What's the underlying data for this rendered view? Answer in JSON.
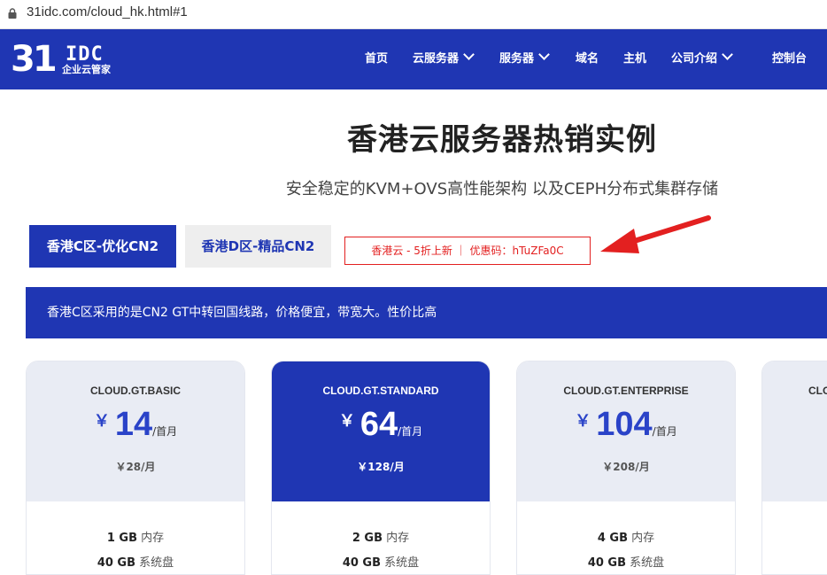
{
  "browser": {
    "url": "31idc.com/cloud_hk.html#1"
  },
  "header": {
    "logo": {
      "number": "31",
      "letters": "IDC",
      "sub": "企业云管家"
    },
    "nav": [
      {
        "label": "首页"
      },
      {
        "label": "云服务器"
      },
      {
        "label": "服务器"
      },
      {
        "label": "域名"
      },
      {
        "label": "主机"
      },
      {
        "label": "公司介绍"
      },
      {
        "label": "控制台"
      }
    ]
  },
  "hero": {
    "title": "香港云服务器热销实例",
    "subtitle": "安全稳定的KVM+OVS高性能架构 以及CEPH分布式集群存储"
  },
  "tabs": [
    {
      "label": "香港C区-优化CN2",
      "active": true
    },
    {
      "label": "香港D区-精品CN2",
      "active": false
    }
  ],
  "promo": "香港云 - 5折上新 ｜ 优惠码：hTuZFa0C",
  "info_bar": "香港C区采用的是CN2 GT中转回国线路，价格便宜，带宽大。性价比高",
  "colors": {
    "brand": "#1f36b3",
    "promo_red": "#e32020",
    "card_bg": "#e9ecf4"
  },
  "cards": [
    {
      "name": "CLOUD.GT.BASIC",
      "currency": "￥",
      "price": "14",
      "per": "/首月",
      "original": "￥28/月",
      "specs": [
        {
          "value": "1 GB",
          "unit": "内存"
        },
        {
          "value": "40 GB",
          "unit": "系统盘"
        }
      ]
    },
    {
      "name": "CLOUD.GT.STANDARD",
      "currency": "￥",
      "price": "64",
      "per": "/首月",
      "original": "￥128/月",
      "specs": [
        {
          "value": "2 GB",
          "unit": "内存"
        },
        {
          "value": "40 GB",
          "unit": "系统盘"
        }
      ]
    },
    {
      "name": "CLOUD.GT.ENTERPRISE",
      "currency": "￥",
      "price": "104",
      "per": "/首月",
      "original": "￥208/月",
      "specs": [
        {
          "value": "4 GB",
          "unit": "内存"
        },
        {
          "value": "40 GB",
          "unit": "系统盘"
        }
      ]
    },
    {
      "name": "CLO",
      "currency": "",
      "price": "",
      "per": "",
      "original": "",
      "specs": []
    }
  ]
}
